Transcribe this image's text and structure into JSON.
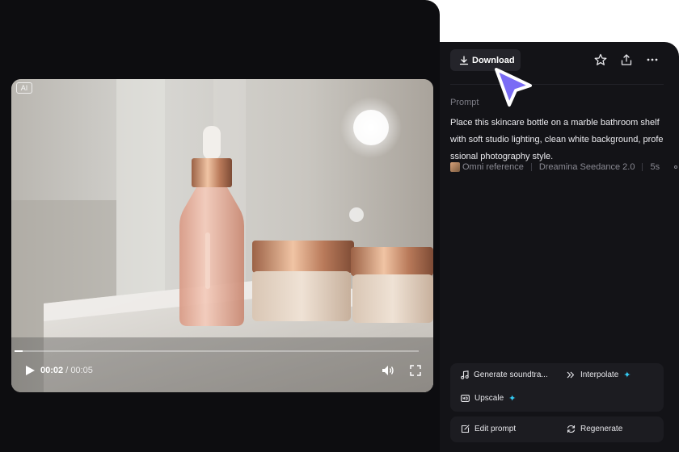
{
  "video": {
    "ai_badge": "AI",
    "current_time": "00:02",
    "duration": "00:05",
    "progress": 0.02
  },
  "toolbar": {
    "download_label": "Download",
    "icons": [
      "download-icon",
      "star-icon",
      "share-icon",
      "more-icon"
    ]
  },
  "prompt": {
    "label": "Prompt",
    "text": "Place this skincare bottle on a marble bathroom shelf with soft studio lighting, clean white background, professional photography style.",
    "reference": "Omni reference",
    "model": "Dreamina Seedance 2.0",
    "length": "5s"
  },
  "actions": {
    "soundtrack": "Generate soundtra...",
    "interpolate": "Interpolate",
    "upscale": "Upscale",
    "edit_prompt": "Edit prompt",
    "regenerate": "Regenerate",
    "sparkle": "✦"
  },
  "colors": {
    "panel_bg": "#131317",
    "left_bg": "#0d0d10",
    "button_bg": "#24242a",
    "cursor": "#7a6cf5",
    "sparkle": "#33c9f2"
  }
}
